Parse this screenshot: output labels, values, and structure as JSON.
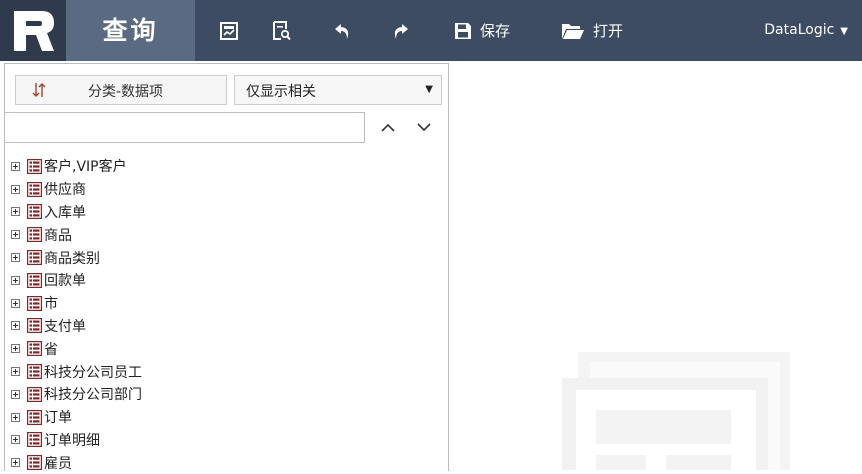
{
  "header": {
    "title": "查询",
    "save_label": "保存",
    "open_label": "打开",
    "user_name": "DataLogic",
    "user_caret": "▼"
  },
  "panel": {
    "sort_label": "分类-数据项",
    "filter_value": "仅显示相关",
    "search_value": "",
    "tree_items": [
      {
        "label": "客户,VIP客户"
      },
      {
        "label": "供应商"
      },
      {
        "label": "入库单"
      },
      {
        "label": "商品"
      },
      {
        "label": "商品类别"
      },
      {
        "label": "回款单"
      },
      {
        "label": "市"
      },
      {
        "label": "支付单"
      },
      {
        "label": "省"
      },
      {
        "label": "科技分公司员工"
      },
      {
        "label": "科技分公司部门"
      },
      {
        "label": "订单"
      },
      {
        "label": "订单明细"
      },
      {
        "label": "雇员"
      }
    ]
  },
  "icons": {
    "logo": "logo-icon",
    "chart": "chart-icon",
    "preview": "search-document-icon",
    "undo": "undo-icon",
    "redo": "redo-icon",
    "save": "save-icon",
    "open": "folder-open-icon",
    "table": "table-icon",
    "expand": "plus-box-icon"
  },
  "colors": {
    "topbar": "#3d4b63",
    "title_bg": "#5b6a83",
    "table_icon": "#7a2a2a"
  }
}
